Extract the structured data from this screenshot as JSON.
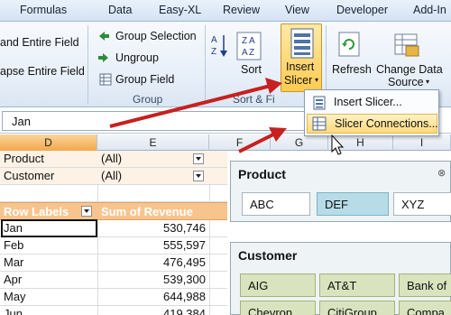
{
  "ribbon": {
    "tabs": [
      "Formulas",
      "Data",
      "Easy-XL",
      "Review",
      "View",
      "Developer",
      "Add-In"
    ],
    "outline": {
      "expand_label": "and Entire Field",
      "collapse_label": "apse Entire Field"
    },
    "group_group": {
      "group_selection": "Group Selection",
      "ungroup": "Ungroup",
      "group_field": "Group Field",
      "label": "Group"
    },
    "sort_group": {
      "sort_label": "Sort",
      "label": "Sort & Fi"
    },
    "insert_slicer": {
      "line1": "Insert",
      "line2": "Slicer"
    },
    "refresh": {
      "label": "Refresh"
    },
    "change_data_source": {
      "line1": "Change Data",
      "line2": "Source"
    }
  },
  "menu": {
    "items": [
      "Insert Slicer...",
      "Slicer Connections..."
    ]
  },
  "formula_bar": {
    "value": "Jan"
  },
  "columns": [
    "D",
    "E",
    "F",
    "G",
    "H",
    "I"
  ],
  "filters": [
    {
      "field": "Product",
      "value": "(All)"
    },
    {
      "field": "Customer",
      "value": "(All)"
    }
  ],
  "pivot": {
    "headers": {
      "row_labels": "Row Labels",
      "sum": "Sum of Revenue"
    },
    "rows": [
      {
        "label": "Jan",
        "value": "530,746"
      },
      {
        "label": "Feb",
        "value": "555,597"
      },
      {
        "label": "Mar",
        "value": "476,495"
      },
      {
        "label": "Apr",
        "value": "539,300"
      },
      {
        "label": "May",
        "value": "644,988"
      },
      {
        "label": "Jun",
        "value": "419,384"
      }
    ]
  },
  "slicers": {
    "product": {
      "title": "Product",
      "items": [
        "ABC",
        "DEF",
        "XYZ"
      ],
      "selected": "DEF"
    },
    "customer": {
      "title": "Customer",
      "items": [
        "AIG",
        "AT&T",
        "Bank of",
        "Chevron",
        "CitiGroup",
        "Compa"
      ]
    }
  },
  "colors": {
    "pivot_header": "#f8c48e",
    "selected_column": "#f3a84d",
    "product_selected": "#b7dce8",
    "customer_item": "#d9e3be",
    "arrow": "#c8201e",
    "menu_highlight": "#ffd97a"
  }
}
